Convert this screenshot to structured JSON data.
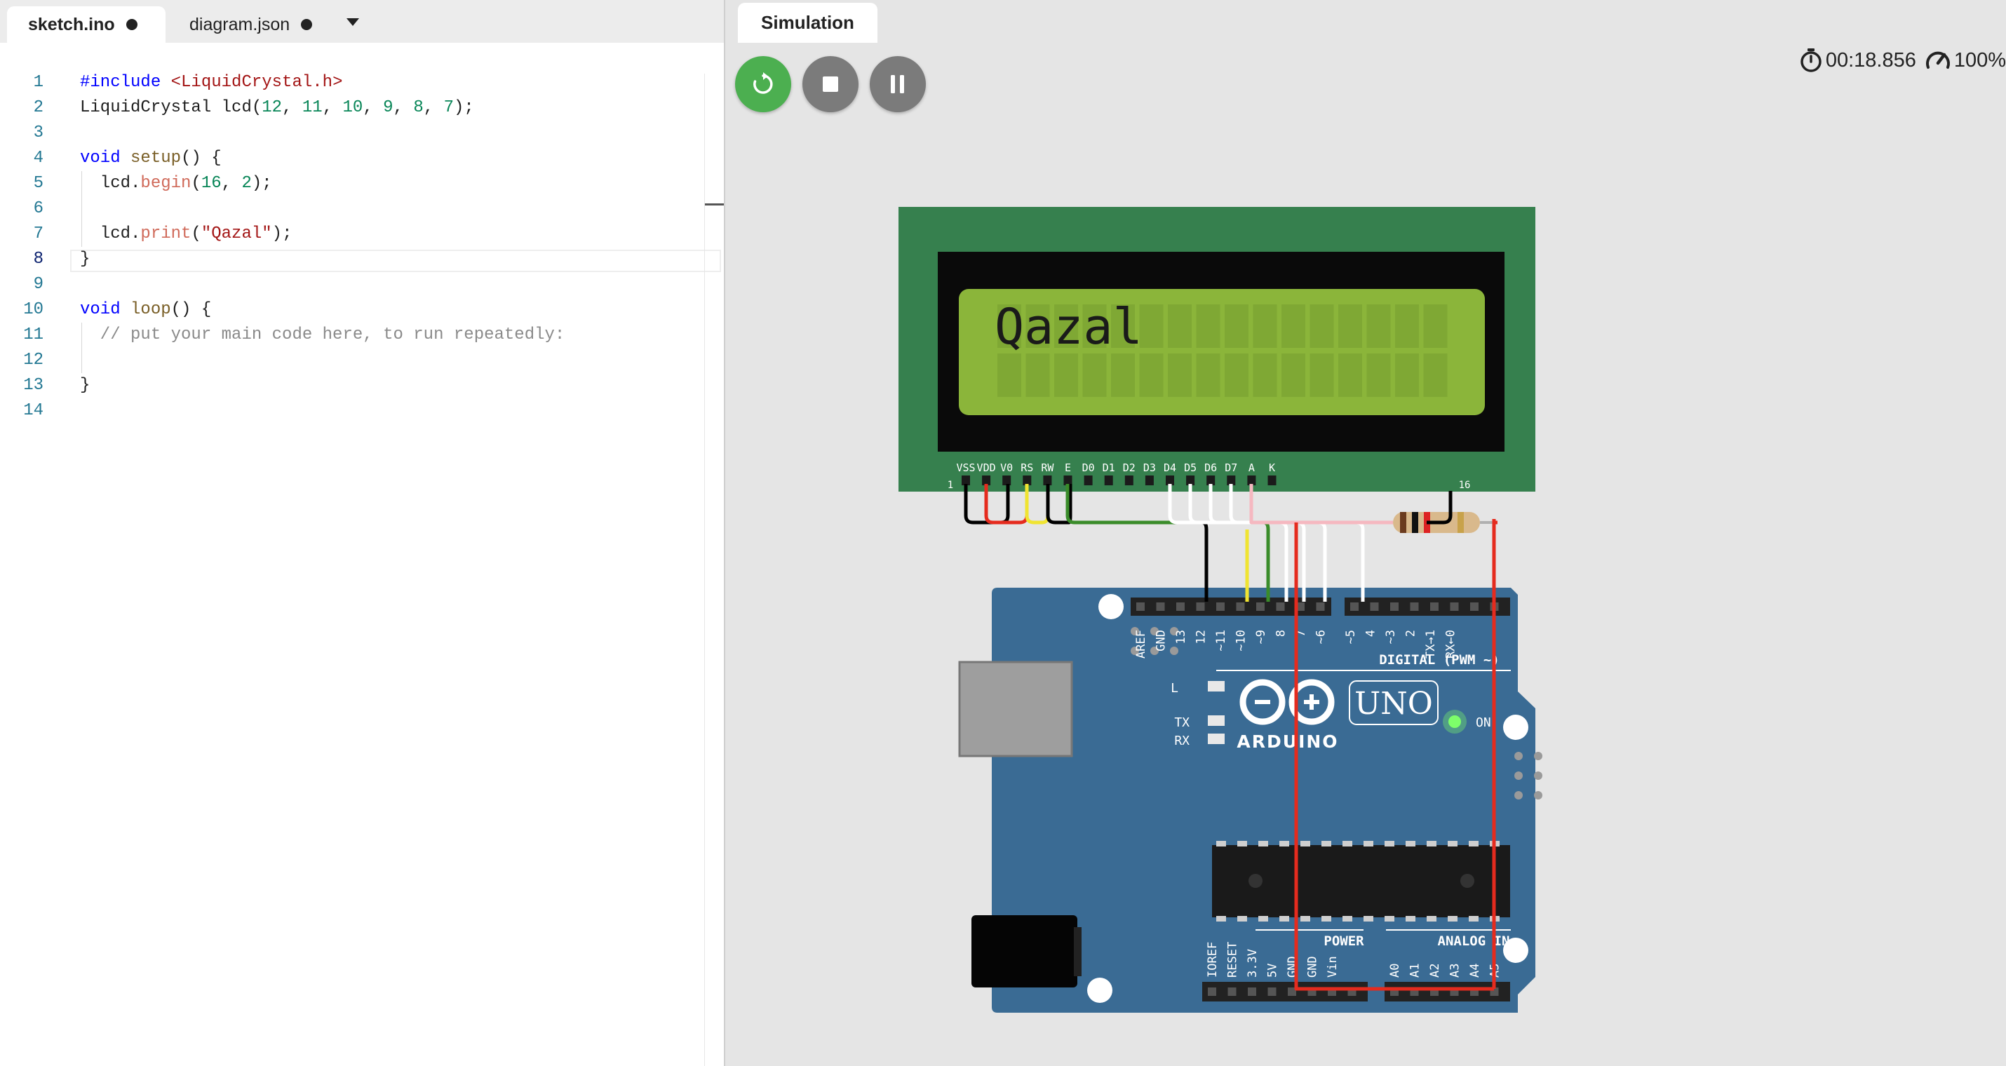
{
  "editor": {
    "tabs": [
      {
        "label": "sketch.ino",
        "modified": true
      },
      {
        "label": "diagram.json",
        "modified": true
      }
    ],
    "active_line": 8,
    "lines": [
      [
        {
          "c": "kw",
          "t": "#include "
        },
        {
          "c": "str",
          "t": "<LiquidCrystal.h>"
        }
      ],
      [
        {
          "c": "",
          "t": "LiquidCrystal lcd("
        },
        {
          "c": "num",
          "t": "12"
        },
        {
          "c": "",
          "t": ", "
        },
        {
          "c": "num",
          "t": "11"
        },
        {
          "c": "",
          "t": ", "
        },
        {
          "c": "num",
          "t": "10"
        },
        {
          "c": "",
          "t": ", "
        },
        {
          "c": "num",
          "t": "9"
        },
        {
          "c": "",
          "t": ", "
        },
        {
          "c": "num",
          "t": "8"
        },
        {
          "c": "",
          "t": ", "
        },
        {
          "c": "num",
          "t": "7"
        },
        {
          "c": "",
          "t": ");"
        }
      ],
      [],
      [
        {
          "c": "kw",
          "t": "void "
        },
        {
          "c": "fn",
          "t": "setup"
        },
        {
          "c": "",
          "t": "() {"
        }
      ],
      [
        {
          "c": "",
          "t": "  lcd."
        },
        {
          "c": "mt",
          "t": "begin"
        },
        {
          "c": "",
          "t": "("
        },
        {
          "c": "num",
          "t": "16"
        },
        {
          "c": "",
          "t": ", "
        },
        {
          "c": "num",
          "t": "2"
        },
        {
          "c": "",
          "t": ");"
        }
      ],
      [],
      [
        {
          "c": "",
          "t": "  lcd."
        },
        {
          "c": "mt",
          "t": "print"
        },
        {
          "c": "",
          "t": "("
        },
        {
          "c": "str",
          "t": "\"Qazal\""
        },
        {
          "c": "",
          "t": ");"
        }
      ],
      [
        {
          "c": "",
          "t": "}"
        }
      ],
      [],
      [
        {
          "c": "kw",
          "t": "void "
        },
        {
          "c": "fn",
          "t": "loop"
        },
        {
          "c": "",
          "t": "() {"
        }
      ],
      [
        {
          "c": "cm",
          "t": "  // put your main code here, to run repeatedly:"
        }
      ],
      [],
      [
        {
          "c": "",
          "t": "}"
        }
      ],
      []
    ]
  },
  "simulation": {
    "tab_label": "Simulation",
    "timer": "00:18.856",
    "speed": "100%",
    "buttons": {
      "restart": "restart",
      "stop": "stop",
      "pause": "pause"
    },
    "icons": {
      "timer": "stopwatch-icon",
      "speed": "speedometer-icon"
    },
    "lcd": {
      "text": "Qazal",
      "pins": [
        "VSS",
        "VDD",
        "V0",
        "RS",
        "RW",
        "E",
        "D0",
        "D1",
        "D2",
        "D3",
        "D4",
        "D5",
        "D6",
        "D7",
        "A",
        "K"
      ],
      "pin_first": "1",
      "pin_last": "16",
      "colors": {
        "board": "#36804e",
        "bezel": "#0a0a0a",
        "screen": "#8bb53a",
        "pixel": "#1a1a1a"
      }
    },
    "arduino": {
      "digital_header": "DIGITAL (PWM ~)",
      "digital_pins": [
        "AREF",
        "GND",
        "13",
        "12",
        "~11",
        "~10",
        "~9",
        "8",
        "7",
        "~6",
        "~5",
        "4",
        "~3",
        "2",
        "TX→1",
        "RX←0"
      ],
      "logo_text": "ARDUINO",
      "model": "UNO",
      "on_label": "ON",
      "led_labels": [
        "L",
        "TX",
        "RX"
      ],
      "power_header": "POWER",
      "power_pins": [
        "IOREF",
        "RESET",
        "3.3V",
        "5V",
        "GND",
        "GND",
        "Vin"
      ],
      "analog_header": "ANALOG IN",
      "analog_pins": [
        "A0",
        "A1",
        "A2",
        "A3",
        "A4",
        "A5"
      ],
      "colors": {
        "board": "#3a6b94",
        "led_on": "#7dff6a"
      }
    }
  }
}
